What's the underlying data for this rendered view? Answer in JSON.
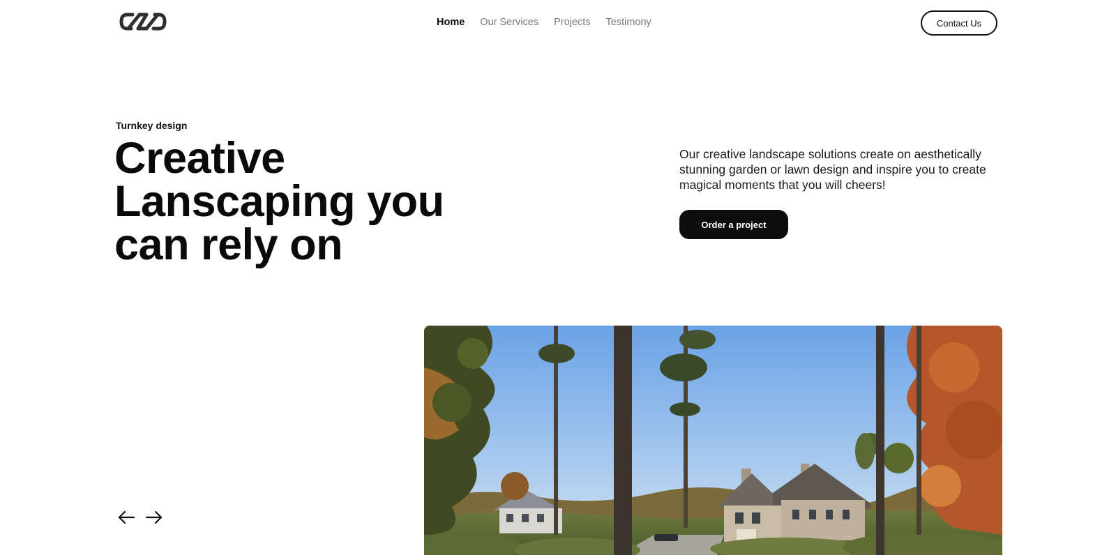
{
  "header": {
    "logo_icon": "infinity-link-logo",
    "nav": [
      {
        "label": "Home",
        "active": true
      },
      {
        "label": "Our Services",
        "active": false
      },
      {
        "label": "Projects",
        "active": false
      },
      {
        "label": "Testimony",
        "active": false
      }
    ],
    "contact_label": "Contact Us"
  },
  "hero": {
    "eyebrow": "Turnkey design",
    "headline_lines": [
      "Creative",
      "Lanscaping you",
      "can rely on"
    ],
    "intro": "Our creative landscape solutions create on aesthetically stunning garden or lawn design and inspire you to create magical moments that you will cheers!",
    "cta_label": "Order a project"
  },
  "carousel": {
    "prev_icon": "arrow-left-icon",
    "next_icon": "arrow-right-icon"
  },
  "colors": {
    "text": "#0c0c0c",
    "nav_inactive": "#7a7a7a",
    "button_dark": "#0c0c0c",
    "background": "#ffffff"
  }
}
